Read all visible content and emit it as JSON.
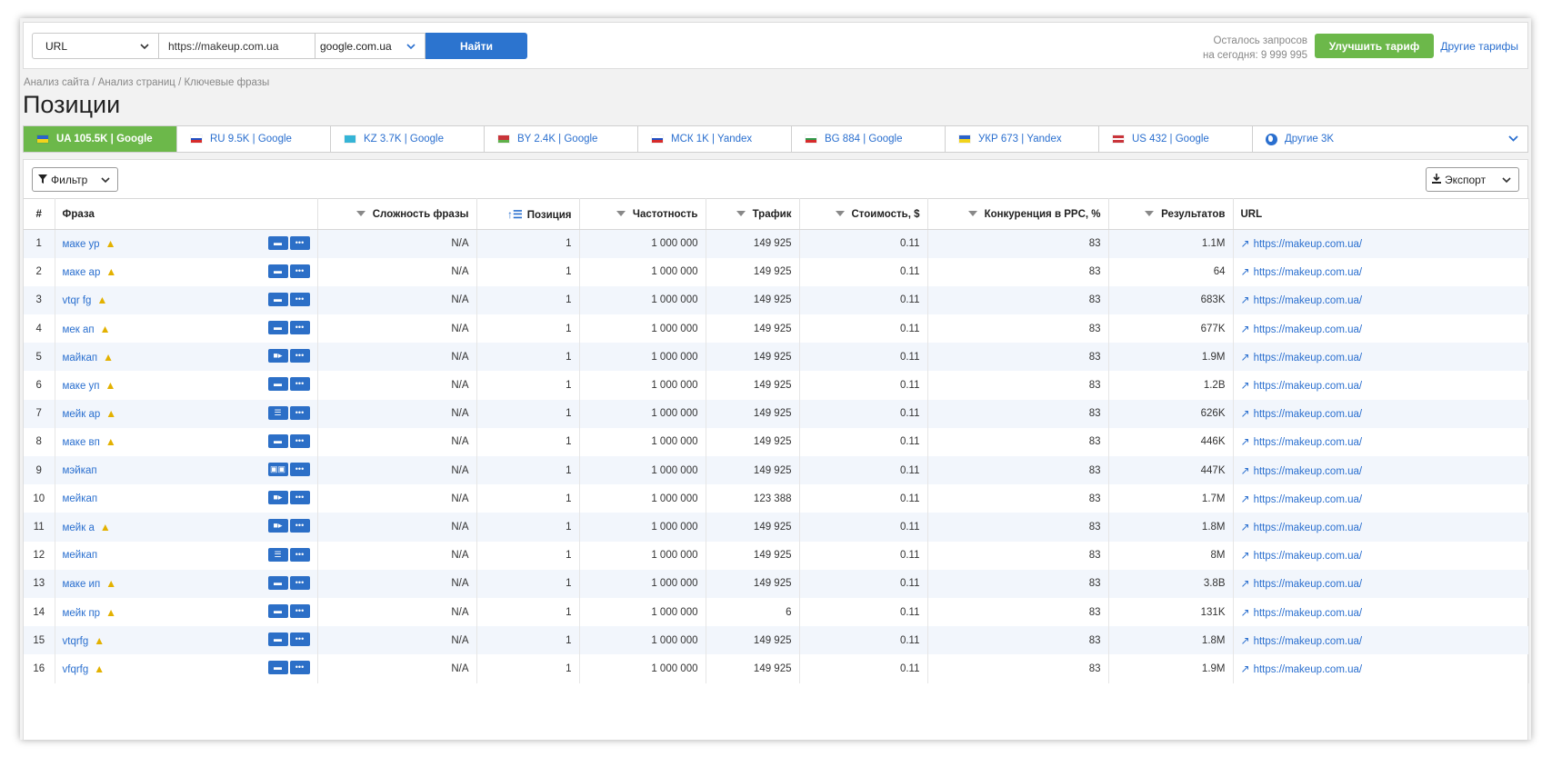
{
  "search": {
    "type_label": "URL",
    "url_value": "https://makeup.com.ua",
    "engine_label": "google.com.ua",
    "find_label": "Найти"
  },
  "account": {
    "quota_line1": "Осталось запросов",
    "quota_line2": "на сегодня: 9 999 995",
    "upgrade_label": "Улучшить тариф",
    "other_plans_label": "Другие тарифы"
  },
  "breadcrumb": "Анализ сайта / Анализ страниц / Ключевые фразы",
  "page_title": "Позиции",
  "tabs": [
    {
      "label": "UA 105.5K | Google",
      "flag": [
        "#2b63c9",
        "#f2d31b"
      ]
    },
    {
      "label": "RU 9.5K | Google",
      "flag": [
        "#ffffff",
        "#1f4fc4",
        "#d62b2b"
      ]
    },
    {
      "label": "KZ 3.7K | Google",
      "flag": [
        "#35b4d6",
        "#35b4d6"
      ]
    },
    {
      "label": "BY 2.4K | Google",
      "flag": [
        "#c9343a",
        "#c9343a",
        "#5fb04a"
      ]
    },
    {
      "label": "МСК 1K | Yandex",
      "flag": [
        "#ffffff",
        "#1f4fc4",
        "#d62b2b"
      ]
    },
    {
      "label": "BG 884 | Google",
      "flag": [
        "#ffffff",
        "#2e9a4a",
        "#d62b2b"
      ]
    },
    {
      "label": "УКР 673 | Yandex",
      "flag": [
        "#2b63c9",
        "#f2d31b"
      ]
    },
    {
      "label": "US 432 | Google",
      "flag": [
        "#c9343a",
        "#ffffff",
        "#c9343a"
      ]
    },
    {
      "label": "Другие 3K",
      "flag": []
    }
  ],
  "toolbar": {
    "filter_label": "Фильтр",
    "export_label": "Экспорт"
  },
  "table": {
    "headers": {
      "num": "#",
      "phrase": "Фраза",
      "difficulty": "Сложность фразы",
      "position": "Позиция",
      "frequency": "Частотность",
      "traffic": "Трафик",
      "cost": "Стоимость, $",
      "ppc": "Конкуренция в PPC, %",
      "results": "Результатов",
      "url": "URL"
    },
    "rows": [
      {
        "n": "1",
        "phrase": "маке ур",
        "warn": true,
        "icon": "chat-icon",
        "diff": "N/A",
        "pos": "1",
        "freq": "1 000 000",
        "traffic": "149 925",
        "cost": "0.11",
        "ppc": "83",
        "results": "1.1M",
        "url": "https://makeup.com.ua/"
      },
      {
        "n": "2",
        "phrase": "маке ар",
        "warn": true,
        "icon": "chat-icon",
        "diff": "N/A",
        "pos": "1",
        "freq": "1 000 000",
        "traffic": "149 925",
        "cost": "0.11",
        "ppc": "83",
        "results": "64",
        "url": "https://makeup.com.ua/"
      },
      {
        "n": "3",
        "phrase": "vtqr fg",
        "warn": true,
        "icon": "chat-icon",
        "diff": "N/A",
        "pos": "1",
        "freq": "1 000 000",
        "traffic": "149 925",
        "cost": "0.11",
        "ppc": "83",
        "results": "683K",
        "url": "https://makeup.com.ua/"
      },
      {
        "n": "4",
        "phrase": "мек ап",
        "warn": true,
        "icon": "chat-icon",
        "diff": "N/A",
        "pos": "1",
        "freq": "1 000 000",
        "traffic": "149 925",
        "cost": "0.11",
        "ppc": "83",
        "results": "677K",
        "url": "https://makeup.com.ua/"
      },
      {
        "n": "5",
        "phrase": "майкап",
        "warn": true,
        "icon": "video-icon",
        "diff": "N/A",
        "pos": "1",
        "freq": "1 000 000",
        "traffic": "149 925",
        "cost": "0.11",
        "ppc": "83",
        "results": "1.9M",
        "url": "https://makeup.com.ua/"
      },
      {
        "n": "6",
        "phrase": "маке уп",
        "warn": true,
        "icon": "chat-icon",
        "diff": "N/A",
        "pos": "1",
        "freq": "1 000 000",
        "traffic": "149 925",
        "cost": "0.11",
        "ppc": "83",
        "results": "1.2B",
        "url": "https://makeup.com.ua/"
      },
      {
        "n": "7",
        "phrase": "мейк ар",
        "warn": true,
        "icon": "snippet-icon",
        "diff": "N/A",
        "pos": "1",
        "freq": "1 000 000",
        "traffic": "149 925",
        "cost": "0.11",
        "ppc": "83",
        "results": "626K",
        "url": "https://makeup.com.ua/"
      },
      {
        "n": "8",
        "phrase": "маке вп",
        "warn": true,
        "icon": "chat-icon",
        "diff": "N/A",
        "pos": "1",
        "freq": "1 000 000",
        "traffic": "149 925",
        "cost": "0.11",
        "ppc": "83",
        "results": "446K",
        "url": "https://makeup.com.ua/"
      },
      {
        "n": "9",
        "phrase": "мэйкап",
        "warn": false,
        "icon": "images-icon",
        "diff": "N/A",
        "pos": "1",
        "freq": "1 000 000",
        "traffic": "149 925",
        "cost": "0.11",
        "ppc": "83",
        "results": "447K",
        "url": "https://makeup.com.ua/"
      },
      {
        "n": "10",
        "phrase": "мейкап",
        "warn": false,
        "icon": "video-icon",
        "diff": "N/A",
        "pos": "1",
        "freq": "1 000 000",
        "traffic": "123 388",
        "cost": "0.11",
        "ppc": "83",
        "results": "1.7M",
        "url": "https://makeup.com.ua/"
      },
      {
        "n": "11",
        "phrase": "мейк а",
        "warn": true,
        "icon": "video-icon",
        "diff": "N/A",
        "pos": "1",
        "freq": "1 000 000",
        "traffic": "149 925",
        "cost": "0.11",
        "ppc": "83",
        "results": "1.8M",
        "url": "https://makeup.com.ua/"
      },
      {
        "n": "12",
        "phrase": "мейкап",
        "warn": false,
        "icon": "snippet-icon",
        "diff": "N/A",
        "pos": "1",
        "freq": "1 000 000",
        "traffic": "149 925",
        "cost": "0.11",
        "ppc": "83",
        "results": "8M",
        "url": "https://makeup.com.ua/"
      },
      {
        "n": "13",
        "phrase": "маке ип",
        "warn": true,
        "icon": "chat-icon",
        "diff": "N/A",
        "pos": "1",
        "freq": "1 000 000",
        "traffic": "149 925",
        "cost": "0.11",
        "ppc": "83",
        "results": "3.8B",
        "url": "https://makeup.com.ua/"
      },
      {
        "n": "14",
        "phrase": "мейк пр",
        "warn": true,
        "icon": "chat-icon",
        "diff": "N/A",
        "pos": "1",
        "freq": "1 000 000",
        "traffic": "6",
        "cost": "0.11",
        "ppc": "83",
        "results": "131K",
        "url": "https://makeup.com.ua/"
      },
      {
        "n": "15",
        "phrase": "vtqrfg",
        "warn": true,
        "icon": "chat-icon",
        "diff": "N/A",
        "pos": "1",
        "freq": "1 000 000",
        "traffic": "149 925",
        "cost": "0.11",
        "ppc": "83",
        "results": "1.8M",
        "url": "https://makeup.com.ua/"
      },
      {
        "n": "16",
        "phrase": "vfqrfg",
        "warn": true,
        "icon": "chat-icon",
        "diff": "N/A",
        "pos": "1",
        "freq": "1 000 000",
        "traffic": "149 925",
        "cost": "0.11",
        "ppc": "83",
        "results": "1.9M",
        "url": "https://makeup.com.ua/"
      }
    ]
  },
  "colors": {
    "accent_blue": "#2c74cf",
    "accent_green": "#6cb84a",
    "warning": "#e3b100"
  }
}
